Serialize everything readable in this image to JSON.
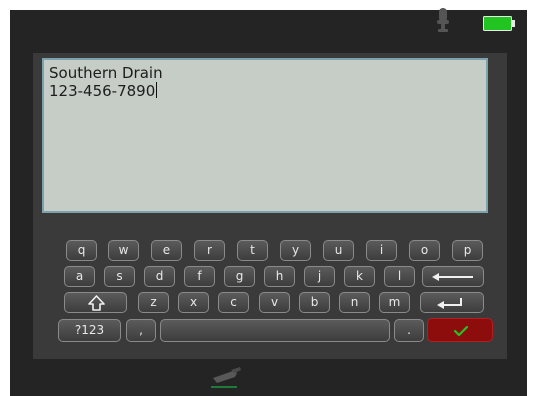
{
  "status_bar": {
    "mic_icon": "microphone-icon",
    "battery_icon": "battery-full-icon",
    "battery_color": "#21c421"
  },
  "text_area": {
    "lines": [
      "Southern Drain",
      "123-456-7890"
    ]
  },
  "keyboard": {
    "row1": [
      "q",
      "w",
      "e",
      "r",
      "t",
      "y",
      "u",
      "i",
      "o",
      "p"
    ],
    "row2": [
      "a",
      "s",
      "d",
      "f",
      "g",
      "h",
      "j",
      "k",
      "l"
    ],
    "row3": [
      "z",
      "x",
      "c",
      "v",
      "b",
      "n",
      "m"
    ],
    "row4": {
      "numbers_label": "?123",
      "comma_label": ",",
      "period_label": "."
    },
    "icons": {
      "backspace": "backspace-arrow-icon",
      "shift": "shift-icon",
      "enter": "enter-icon",
      "confirm": "checkmark-icon"
    },
    "colors": {
      "confirm_bg": "#8d0d0d",
      "confirm_check": "#25c225"
    }
  },
  "dock": {
    "icon": "paint-tool-icon"
  }
}
